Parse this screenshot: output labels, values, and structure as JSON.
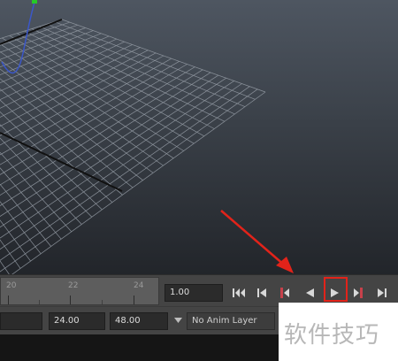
{
  "timeline": {
    "tick_labels": [
      "20",
      "22",
      "24"
    ],
    "current_time": "1.00"
  },
  "playback_controls": [
    {
      "name": "go-to-start",
      "icon": "skip-to-start-icon"
    },
    {
      "name": "step-back-frame",
      "icon": "step-back-icon"
    },
    {
      "name": "step-back-key",
      "icon": "step-back-key-icon"
    },
    {
      "name": "play-backwards",
      "icon": "play-backwards-icon"
    },
    {
      "name": "play-forwards",
      "icon": "play-forwards-icon"
    },
    {
      "name": "step-forward-key",
      "icon": "step-forward-key-icon"
    },
    {
      "name": "go-to-end",
      "icon": "skip-to-end-icon"
    }
  ],
  "range": {
    "end_time": "24.00",
    "anim_end_time": "48.00",
    "anim_layer": "No Anim Layer"
  },
  "watermark": "软件技巧",
  "colors": {
    "highlight": "#e2231a",
    "key_red": "#c8414b",
    "viewport_top": "#4e5661",
    "viewport_bottom": "#22252a"
  }
}
